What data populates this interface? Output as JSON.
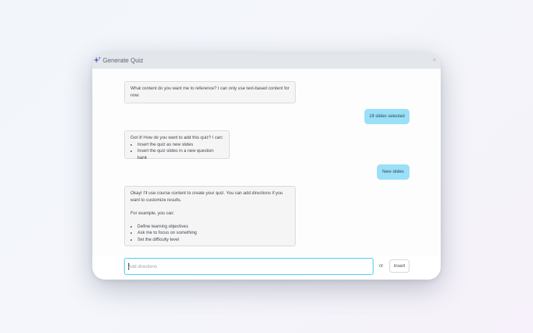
{
  "window": {
    "title": "Generate Quiz",
    "title_icon": "sparkle-icon",
    "close_label": "✕"
  },
  "messages": [
    {
      "role": "assistant",
      "text": "What content do you want me to reference? I can only use text-based content for now."
    },
    {
      "role": "user",
      "text": "19 slides selected"
    },
    {
      "role": "assistant",
      "intro": "Got it! How do you want to add this quiz? I can:",
      "bullets": [
        "Insert the quiz as new slides",
        "Insert the quiz slides in a new question bank"
      ]
    },
    {
      "role": "user",
      "text": "New slides"
    },
    {
      "role": "assistant",
      "intro": "Okay! I'll use course content to create your quiz. You can add directions if you want to customize results.",
      "sub": "For example, you can:",
      "bullets": [
        "Define learning objectives",
        "Ask me to focus on something",
        "Set the difficulty level"
      ]
    }
  ],
  "composer": {
    "placeholder": "Add directions",
    "value": "",
    "or_label": "or",
    "insert_label": "Insert"
  },
  "colors": {
    "user_bubble": "#99e0f8",
    "focus_border": "#5ccff2",
    "titlebar": "#e3e7ec",
    "sparkle": "#6b5bd6"
  }
}
